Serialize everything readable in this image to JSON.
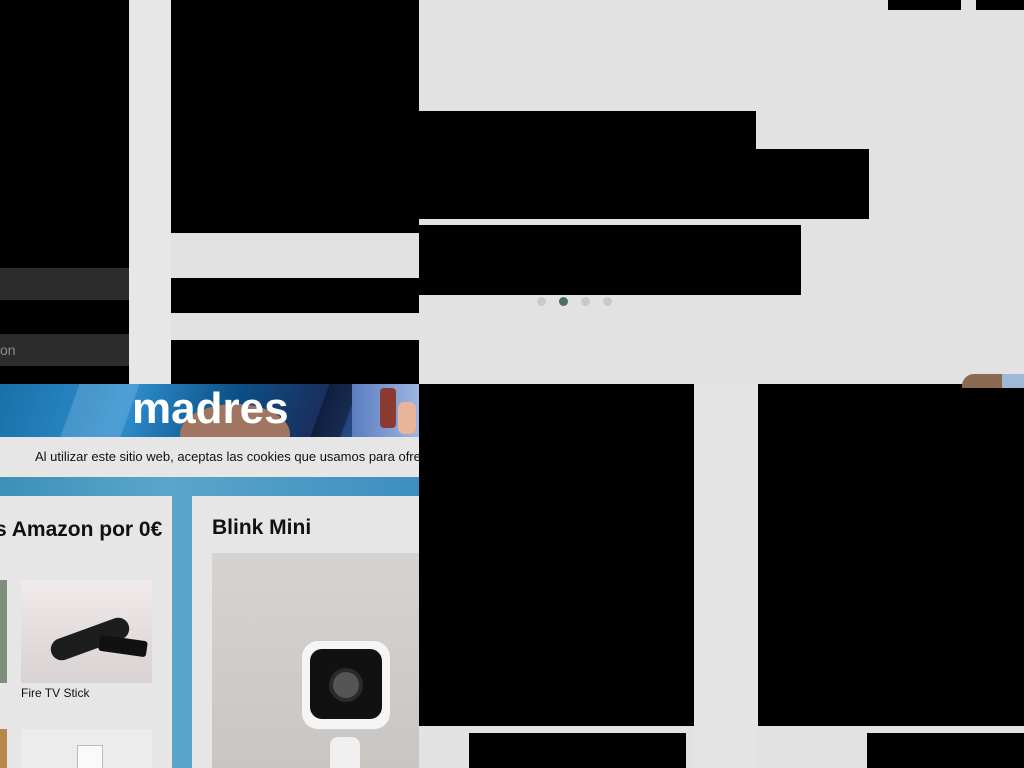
{
  "left_panel": {
    "input_text": "on"
  },
  "carousel": {
    "dot_count": 4,
    "active_dot": 2
  },
  "banner": {
    "title": "madres"
  },
  "cookie_notice": {
    "text": "Al utilizar este sitio web, aceptas las cookies que usamos para ofre"
  },
  "cards": {
    "amazon": {
      "title": "s Amazon por 0€",
      "items": [
        {
          "label": "Fire TV Stick"
        }
      ]
    },
    "blink": {
      "title": "Blink Mini"
    }
  },
  "colors": {
    "page_background": "#e2e2e2",
    "active_dot": "#4d6f63",
    "inactive_dot": "#c9c9c9",
    "banner_blue": "#2f8fcf",
    "band_blue": "#3c90b8"
  }
}
